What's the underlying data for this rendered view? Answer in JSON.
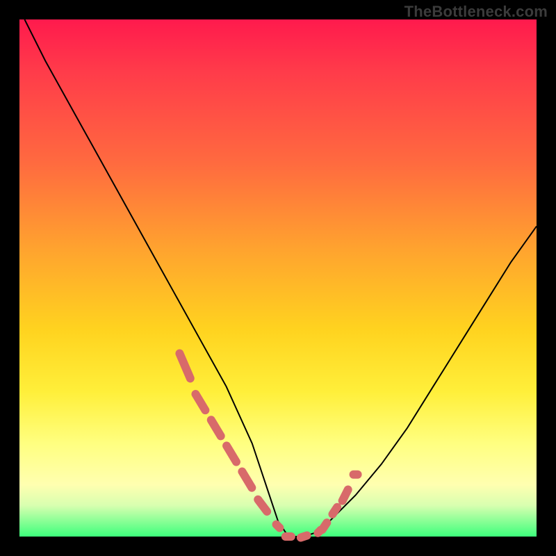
{
  "watermark": "TheBottleneck.com",
  "colors": {
    "background": "#000000",
    "gradient_top": "#ff1a4d",
    "gradient_mid": "#ffd31f",
    "gradient_bottom": "#3dff7c",
    "curve": "#000000",
    "marker": "#d86a6a"
  },
  "chart_data": {
    "type": "line",
    "title": "",
    "xlabel": "",
    "ylabel": "",
    "xlim": [
      0,
      100
    ],
    "ylim": [
      0,
      100
    ],
    "series": [
      {
        "name": "curve",
        "x": [
          1,
          5,
          10,
          15,
          20,
          25,
          30,
          35,
          40,
          45,
          48,
          50,
          52,
          55,
          58,
          60,
          65,
          70,
          75,
          80,
          85,
          90,
          95,
          100
        ],
        "values": [
          100,
          92,
          83,
          74,
          65,
          56,
          47,
          38,
          29,
          18,
          9,
          3,
          0,
          0,
          1,
          3,
          8,
          14,
          21,
          29,
          37,
          45,
          53,
          60
        ]
      }
    ],
    "markers": {
      "name": "bottleneck-zone",
      "x": [
        32,
        35,
        38,
        41,
        44,
        47,
        50,
        52,
        55,
        58,
        59,
        61,
        63,
        65
      ],
      "values": [
        33,
        26,
        21,
        16,
        11,
        6,
        2,
        0,
        0,
        1,
        2,
        5,
        8,
        12
      ]
    }
  }
}
